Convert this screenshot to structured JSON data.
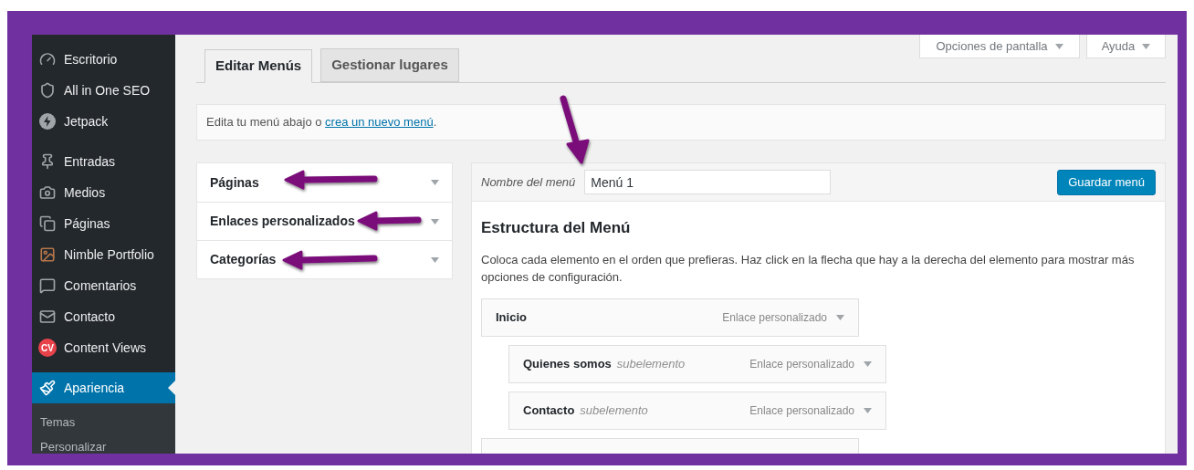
{
  "sidebar": {
    "groups": [
      [
        {
          "label": "Escritorio",
          "selected": false
        },
        {
          "label": "All in One SEO",
          "selected": false
        },
        {
          "label": "Jetpack",
          "selected": false
        }
      ],
      [
        {
          "label": "Entradas",
          "selected": false
        },
        {
          "label": "Medios",
          "selected": false
        },
        {
          "label": "Páginas",
          "selected": false
        },
        {
          "label": "Nimble Portfolio",
          "selected": false
        },
        {
          "label": "Comentarios",
          "selected": false
        },
        {
          "label": "Contacto",
          "selected": false
        },
        {
          "label": "Content Views",
          "selected": false,
          "badge": "CV"
        }
      ],
      [
        {
          "label": "Apariencia",
          "selected": true,
          "children": [
            {
              "label": "Temas"
            },
            {
              "label": "Personalizar"
            }
          ]
        }
      ]
    ]
  },
  "top_buttons": [
    "Opciones de pantalla",
    "Ayuda"
  ],
  "tabs": [
    {
      "label": "Editar Menús",
      "selected": true
    },
    {
      "label": "Gestionar lugares",
      "selected": false
    }
  ],
  "notice": {
    "text": "Edita tu menú abajo o ",
    "link": "crea un nuevo menú",
    "after": "."
  },
  "accordion": [
    {
      "label": "Páginas"
    },
    {
      "label": "Enlaces personalizados"
    },
    {
      "label": "Categorías"
    }
  ],
  "menu_editor": {
    "name_label": "Nombre del menú",
    "name_value": "Menú 1",
    "save_button": "Guardar menú",
    "title": "Estructura del Menú",
    "description": "Coloca cada elemento en el orden que prefieras. Haz click en la flecha que hay a la derecha del elemento para mostrar más opciones de configuración.",
    "items": [
      {
        "label": "Inicio",
        "type": "Enlace personalizado",
        "children": [
          {
            "label": "Quienes somos",
            "note": "subelemento",
            "type": "Enlace personalizado"
          },
          {
            "label": "Contacto",
            "note": "subelemento",
            "type": "Enlace personalizado"
          }
        ]
      }
    ]
  }
}
